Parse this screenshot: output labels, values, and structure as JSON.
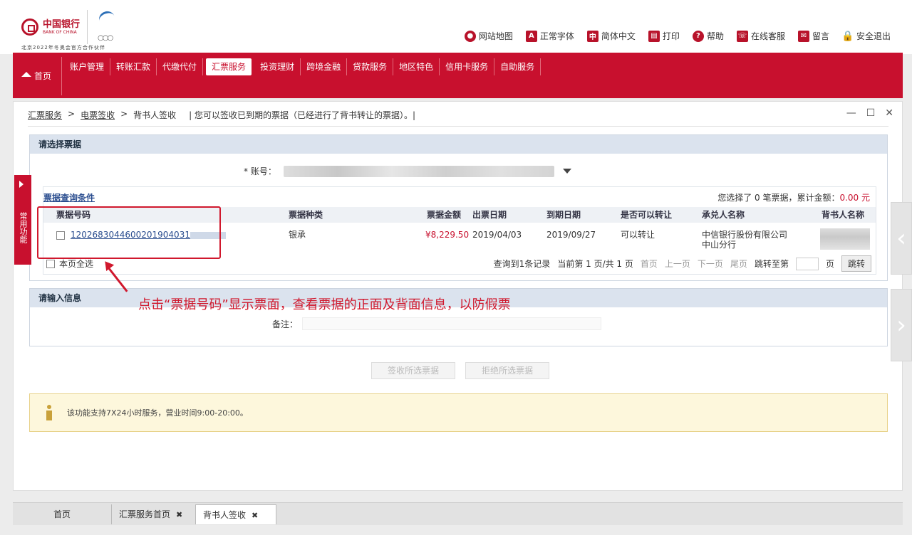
{
  "header": {
    "logo_cn": "中国银行",
    "logo_en": "BANK OF CHINA",
    "tagline": "北京2022年冬奥会官方合作伙伴",
    "links": [
      {
        "icon": "map-pin-icon",
        "label": "网站地图"
      },
      {
        "icon": "font-a-icon",
        "label": "正常字体"
      },
      {
        "icon": "language-icon",
        "label": "简体中文"
      },
      {
        "icon": "printer-icon",
        "label": "打印"
      },
      {
        "icon": "help-icon",
        "label": "帮助"
      },
      {
        "icon": "support-icon",
        "label": "在线客服"
      },
      {
        "icon": "mail-icon",
        "label": "留言"
      },
      {
        "icon": "lock-icon",
        "label": "安全退出"
      }
    ]
  },
  "nav": {
    "home": "首页",
    "items": [
      "账户管理",
      "转账汇款",
      "代缴代付",
      "汇票服务",
      "投资理财",
      "跨境金融",
      "贷款服务",
      "地区特色",
      "信用卡服务",
      "自助服务"
    ],
    "active_index": 3
  },
  "breadcrumb": {
    "root": "汇票服务",
    "level2": "电票签收",
    "current": "背书人签收",
    "hint": "| 您可以签收已到期的票据（已经进行了背书转让的票据）。|"
  },
  "section1": {
    "title": "请选择票据",
    "account_label": "* 账号：",
    "inner_title": "票据查询条件",
    "summary_prefix": "您选择了 0 笔票据，累计金额：",
    "summary_amount": "0.00 元",
    "columns": [
      "票据号码",
      "票据种类",
      "票据金额",
      "出票日期",
      "到期日期",
      "是否可以转让",
      "承兑人名称",
      "背书人名称"
    ],
    "rows": [
      {
        "bill_no": "1202683044600201904031",
        "kind": "银承",
        "amount": "¥8,229.50",
        "issue_date": "2019/04/03",
        "due_date": "2019/09/27",
        "transferable": "可以转让",
        "acceptor": "中信银行股份有限公司中山分行"
      }
    ],
    "select_all": "本页全选",
    "pager": {
      "total": "查询到1条记录",
      "page_info": "当前第 1 页/共 1 页",
      "first": "首页",
      "prev": "上一页",
      "next": "下一页",
      "last": "尾页",
      "goto": "跳转至第",
      "page_unit": "页",
      "go_button": "跳转"
    }
  },
  "section2": {
    "title": "请输入信息",
    "remark_label": "备注："
  },
  "annotation": "点击“票据号码”显示票面，查看票据的正面及背面信息，以防假票",
  "buttons": {
    "sign": "签收所选票据",
    "reject": "拒绝所选票据"
  },
  "notice": "该功能支持7X24小时服务，营业时间9:00-20:00。",
  "side_tab": "常用功能",
  "bottom_tabs": [
    "首页",
    "汇票服务首页",
    "背书人签收"
  ],
  "colors": {
    "brand_red": "#c8102e",
    "annotation_red": "#d0182d",
    "link_blue": "#2a4d8f"
  }
}
